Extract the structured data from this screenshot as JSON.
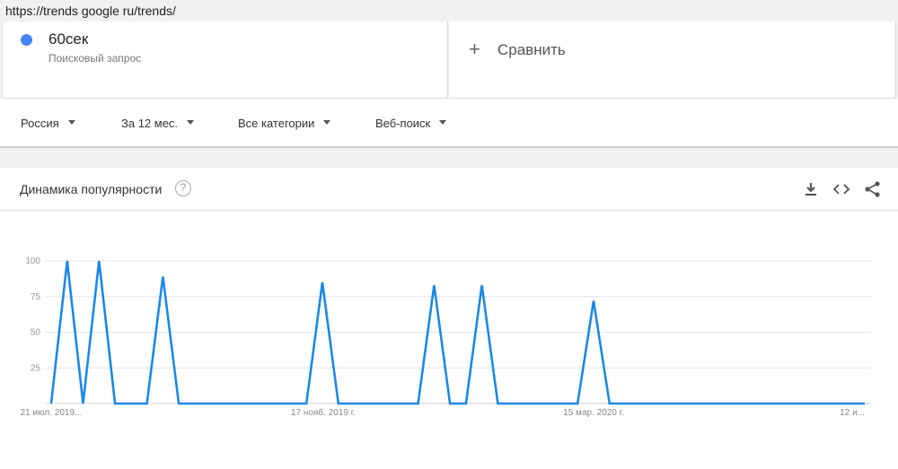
{
  "browser": {
    "url": "https://trends google ru/trends/"
  },
  "term": {
    "name": "60сек",
    "subtitle": "Поисковый запрос",
    "color": "#4285f4"
  },
  "compare": {
    "label": "Сравнить"
  },
  "filters": [
    {
      "label": "Россия"
    },
    {
      "label": "За 12 мес."
    },
    {
      "label": "Все категории"
    },
    {
      "label": "Веб-поиск"
    }
  ],
  "chart_header": {
    "title": "Динамика популярности",
    "icons": [
      "help-icon",
      "download-icon",
      "embed-icon",
      "share-icon"
    ]
  },
  "chart_data": {
    "type": "line",
    "title": "Динамика популярности",
    "xlabel": "",
    "ylabel": "",
    "ylim": [
      0,
      100
    ],
    "yticks": [
      "25",
      "50",
      "75",
      "100"
    ],
    "x_tick_labels": [
      "21 июл. 2019...",
      "17 нояб. 2019 г.",
      "15 мар. 2020 г.",
      "12 и..."
    ],
    "grid": true,
    "color": "#1e88e5",
    "series": [
      {
        "values": [
          0,
          100,
          0,
          100,
          0,
          0,
          0,
          89,
          0,
          0,
          0,
          0,
          0,
          0,
          0,
          0,
          0,
          85,
          0,
          0,
          0,
          0,
          0,
          0,
          83,
          0,
          0,
          83,
          0,
          0,
          0,
          0,
          0,
          0,
          72,
          0,
          0,
          0,
          0,
          0,
          0,
          0,
          0,
          0,
          0,
          0,
          0,
          0,
          0,
          0,
          0,
          0
        ]
      }
    ]
  }
}
